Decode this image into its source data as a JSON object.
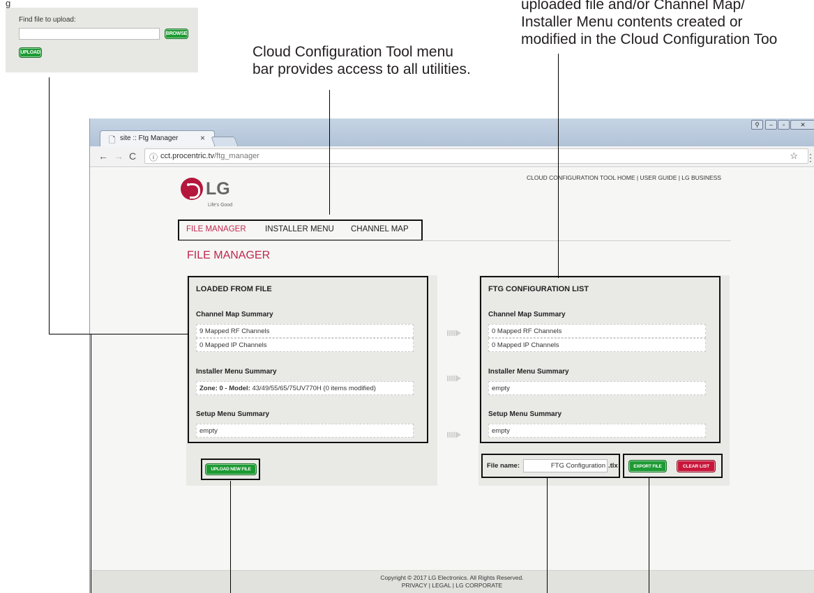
{
  "annotations": {
    "inset_top_partial": "g",
    "menu_bar_callout": [
      "Cloud Configuration Tool menu",
      "bar provides access to all utilities."
    ],
    "right_callout": [
      "uploaded file and/or Channel Map/",
      "Installer Menu contents created or",
      "modified in the Cloud Configuration Too"
    ]
  },
  "inset": {
    "label": "Find file to upload:",
    "browse_label": "BROWSE",
    "upload_label": "UPLOAD"
  },
  "browser": {
    "tab_title": "site :: Ftg Manager",
    "tab_close": "×",
    "url_host": "cct.procentric.tv",
    "url_path": "/ftg_manager"
  },
  "page": {
    "top_links": "CLOUD CONFIGURATION TOOL HOME  |  USER GUIDE  |  LG BUSINESS",
    "logo_text": "LG",
    "logo_tagline": "Life's Good",
    "nav": [
      "FILE MANAGER",
      "INSTALLER MENU",
      "CHANNEL MAP"
    ],
    "title": "FILE MANAGER",
    "loaded": {
      "heading": "LOADED FROM FILE",
      "channel_summary_label": "Channel Map Summary",
      "rf_channels": "9 Mapped RF Channels",
      "ip_channels": "0 Mapped IP Channels",
      "installer_summary_label": "Installer Menu Summary",
      "installer_zone_bold": "Zone: 0 - Model:",
      "installer_zone_rest": " 43/49/55/65/75UV770H (0 items modified)",
      "setup_summary_label": "Setup Menu Summary",
      "setup_value": "empty"
    },
    "ftg": {
      "heading": "FTG CONFIGURATION LIST",
      "channel_summary_label": "Channel Map Summary",
      "rf_channels": "0 Mapped RF Channels",
      "ip_channels": "0 Mapped IP Channels",
      "installer_summary_label": "Installer Menu Summary",
      "installer_value": "empty",
      "setup_summary_label": "Setup Menu Summary",
      "setup_value": "empty"
    },
    "upload_new_label": "UPLOAD NEW FILE",
    "file_name_label": "File name:",
    "file_name_value": "FTG Configuration",
    "file_ext": ".tlx",
    "export_label": "EXPORT FILE",
    "clear_label": "CLEAR LIST",
    "copyright": "Copyright © 2017 LG Electronics. All Rights Reserved.",
    "footer_links": "PRIVACY | LEGAL | LG CORPORATE"
  },
  "colors": {
    "accent": "#c0264f",
    "green_button": "#1d9a33",
    "red_button": "#c8163a"
  }
}
